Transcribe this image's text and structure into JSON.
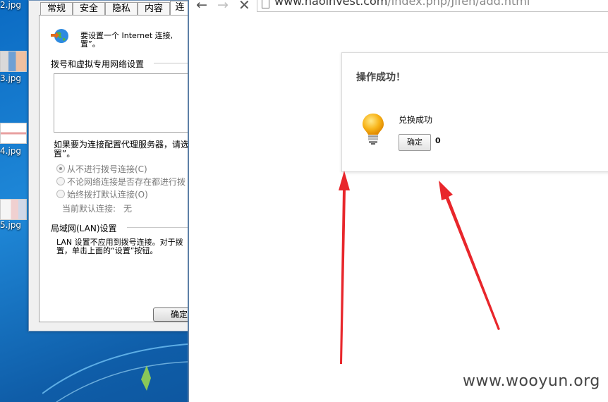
{
  "desktop": {
    "files": [
      "2.jpg",
      "3.jpg",
      "4.jpg",
      "5.jpg"
    ]
  },
  "internet_options": {
    "tabs": [
      "常规",
      "安全",
      "隐私",
      "内容",
      "连"
    ],
    "intro_line1": "要设置一个 Internet 连接,",
    "intro_line2": "置”。",
    "dialup_section_title": "拨号和虚拟专用网络设置",
    "proxy_text_line1": "如果要为连接配置代理服务器，请选",
    "proxy_text_line2": "置”。",
    "radio_options": [
      {
        "label": "从不进行拨号连接(C)",
        "selected": true
      },
      {
        "label": "不论网络连接是否存在都进行拨",
        "selected": false
      },
      {
        "label": "始终拨打默认连接(O)",
        "selected": false
      }
    ],
    "default_connection_label": "当前默认连接:",
    "default_connection_value": "无",
    "lan_section_title": "局域网(LAN)设置",
    "lan_text_line1": "LAN 设置不应用到拨号连接。对于拨",
    "lan_text_line2": "置，单击上面的“设置”按钮。",
    "ok_button": "确定"
  },
  "browser": {
    "url_host": "www.haoinvest.com",
    "url_path": "/index.php/Jifen/add.html"
  },
  "message": {
    "title": "操作成功！",
    "text": "兑换成功",
    "confirm_button": "确定",
    "count": "0"
  },
  "annotations": {
    "arrow_color": "#e8262b"
  },
  "watermark": "www.wooyun.org"
}
